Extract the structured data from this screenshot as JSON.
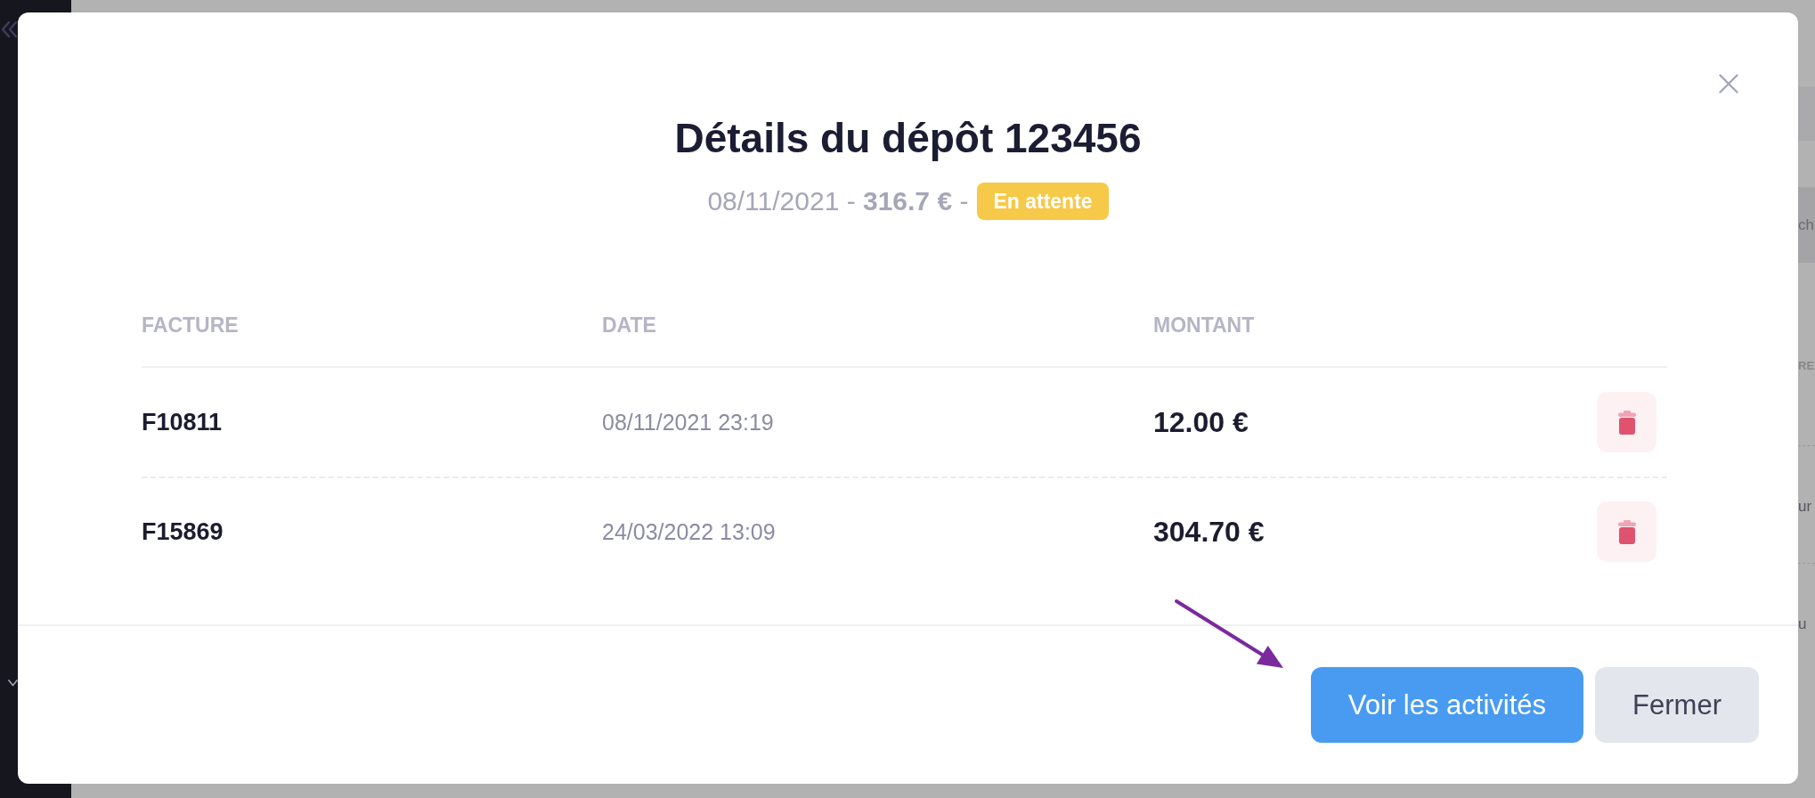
{
  "background": {
    "fragments": [
      {
        "kind": "field",
        "text": "ch"
      },
      {
        "kind": "heading",
        "text": "RE"
      },
      {
        "kind": "row",
        "text": "ur"
      },
      {
        "kind": "row",
        "text": "u"
      }
    ]
  },
  "modal": {
    "title": "Détails du dépôt 123456",
    "subtitle": "08/11/2021 - **316.7 €** -",
    "status_badge": "En attente",
    "table": {
      "columns": [
        "FACTURE",
        "DATE",
        "MONTANT"
      ],
      "rows": [
        {
          "invoice": "F10811",
          "date": "08/11/2021 23:19",
          "amount": "12.00 €"
        },
        {
          "invoice": "F15869",
          "date": "24/03/2022 13:09",
          "amount": "304.70 €"
        }
      ]
    },
    "buttons": [
      {
        "label": "Voir les activités",
        "kind": "primary"
      },
      {
        "label": "Fermer",
        "kind": "secondary"
      }
    ]
  }
}
